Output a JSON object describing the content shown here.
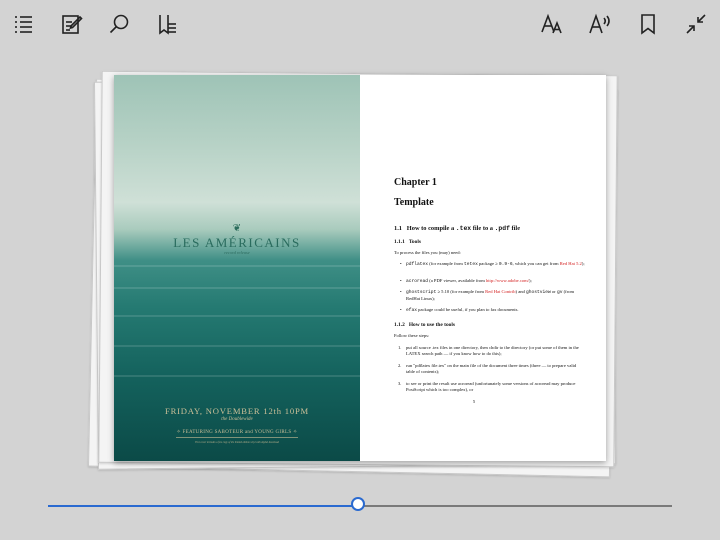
{
  "toolbar": {
    "icons": [
      "table-of-contents-icon",
      "notes-icon",
      "search-icon",
      "bookmarks-list-icon",
      "text-size-icon",
      "read-aloud-icon",
      "bookmark-icon",
      "exit-fullscreen-icon"
    ]
  },
  "cover": {
    "title": "LES AMÉRICAINS",
    "subtitle": "record release",
    "date": "FRIDAY, NOVEMBER 12th 10PM",
    "venue": "the Doublewide",
    "featuring": "✧ FEATURING SABOTEUR and YOUNG GIRLS ✧",
    "fineprint": "Free cover includes a free copy of the limited edition vinyl with digital download"
  },
  "page": {
    "chapter": "Chapter 1",
    "title": "Template",
    "s1_num": "1.1",
    "s1_a": "How to compile a ",
    "s1_code1": ".tex",
    "s1_b": " file to a ",
    "s1_code2": ".pdf",
    "s1_c": " file",
    "s11_num": "1.1.1",
    "s11_title": "Tools",
    "s11_intro": "To process the files you (may) need:",
    "b1_code": "pdflatex",
    "b1_text": " (for example from ",
    "b1_code2": "tetex",
    "b1_text2": " package ≥ ",
    "b1_code3": "0.9-6",
    "b1_text3": ", which you can get from ",
    "b1_link": "Red Hat 5.2",
    "b1_end": ");",
    "b2_code": "acroread",
    "b2_text": " (a PDF viewer, available from ",
    "b2_link": "http://www.adobe.com/",
    "b2_end": ");",
    "b3_code": "ghostscript",
    "b3_text": " ≥ 5.10 (for example from ",
    "b3_link": "Red Hat Contrib",
    "b3_text2": ") and ",
    "b3_code2": "ghostview",
    "b3_text3": " or ",
    "b3_code3": "gv",
    "b3_end": " (from RedHat Linux);",
    "b4_code": "efax",
    "b4_text": " package could be useful, if you plan to fax documents.",
    "s12_num": "1.1.2",
    "s12_title": "How to use the tools",
    "s12_intro": "Follow these steps:",
    "n1": "put all source .tex files in one directory, then chdir to the directory (or put some of them in the LATEX search path — if you know how to do this);",
    "n2": "run \"pdflatex file.tex\" on the main file of the document three times (three — to prepare valid table of contents);",
    "n3": "to see or print the result use acroread (unfortunately some versions of acroread may produce PostScript which is too complex), or",
    "page_number": "5"
  },
  "progress": {
    "value": 0.497
  },
  "colors": {
    "accent": "#2a6ad0",
    "background": "#d3d3d3"
  }
}
